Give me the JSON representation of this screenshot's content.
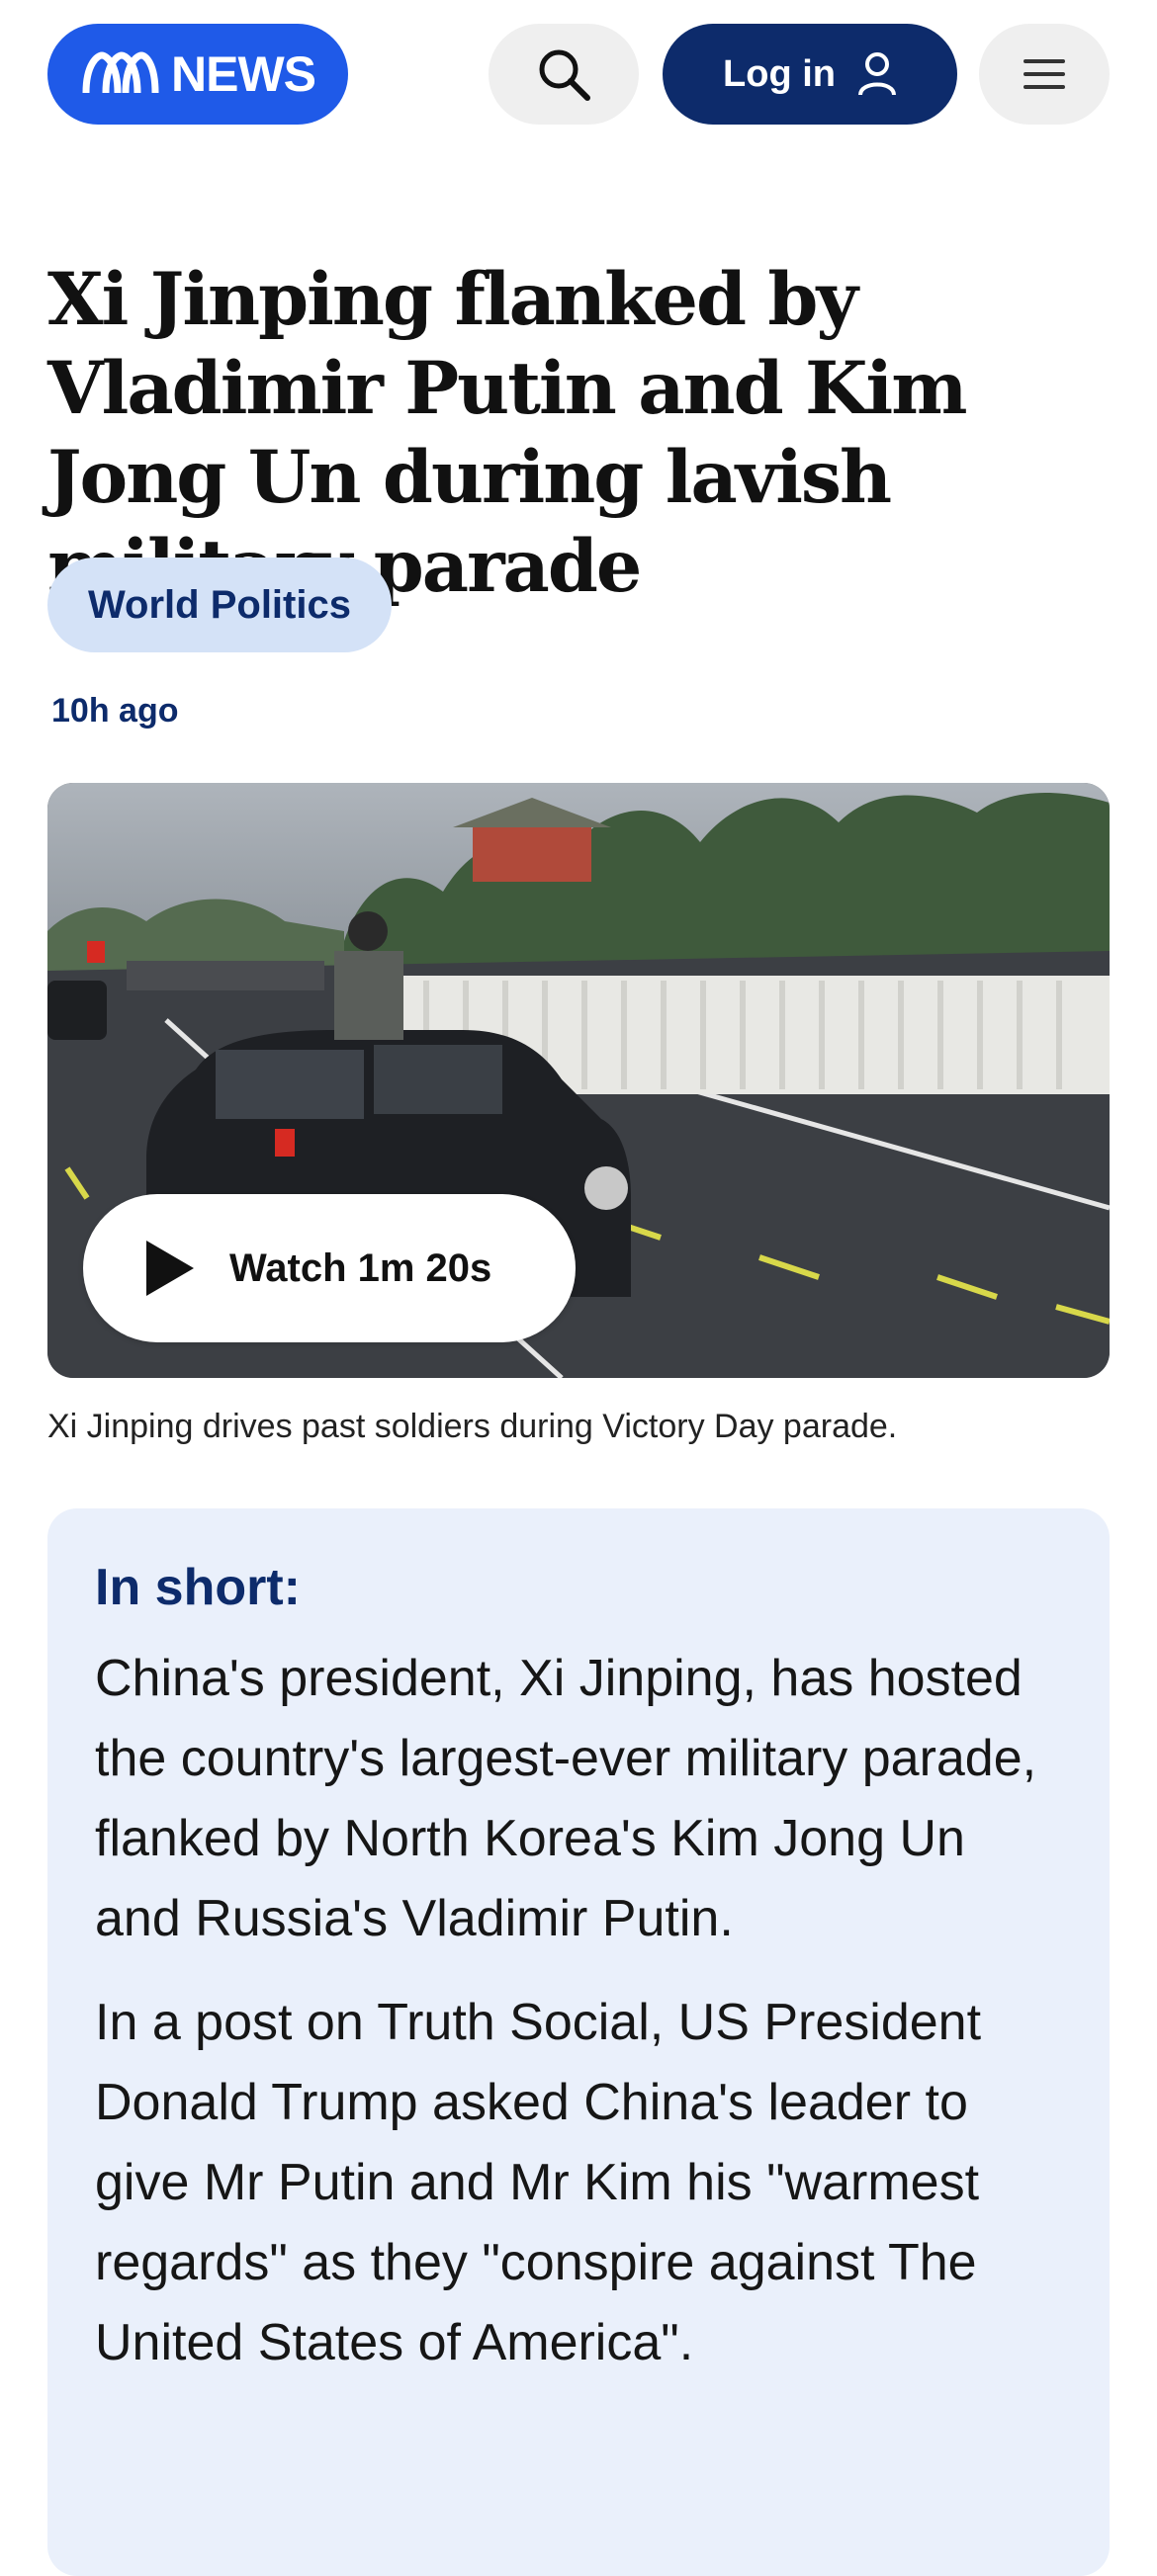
{
  "header": {
    "logo_text": "NEWS",
    "login_label": "Log in"
  },
  "article": {
    "headline": "Xi Jinping flanked by Vladimir Putin and Kim Jong Un during lavish military parade",
    "topic": "World Politics",
    "timestamp": "10h ago",
    "video": {
      "watch_label": "Watch 1m 20s",
      "caption": "Xi Jinping drives past soldiers during Victory Day parade."
    },
    "in_short": {
      "title": "In short:",
      "paragraphs": [
        "China's president, Xi Jinping, has hosted the country's largest-ever military parade, flanked by North Korea's Kim Jong Un and Russia's Vladimir Putin.",
        "In a post on Truth Social, US President Donald Trump asked China's leader to give Mr Putin and Mr Kim his \"warmest regards\" as they \"conspire against The United States of America\"."
      ]
    }
  },
  "colors": {
    "brand_blue": "#1f5ae8",
    "navy": "#0d2b6b",
    "tag_bg": "#d4e2f7",
    "inshort_bg": "#eaf0fb"
  },
  "icons": {
    "search": "search-icon",
    "user": "user-icon",
    "menu": "menu-icon",
    "play": "play-icon",
    "logo": "abc-logo-icon"
  }
}
